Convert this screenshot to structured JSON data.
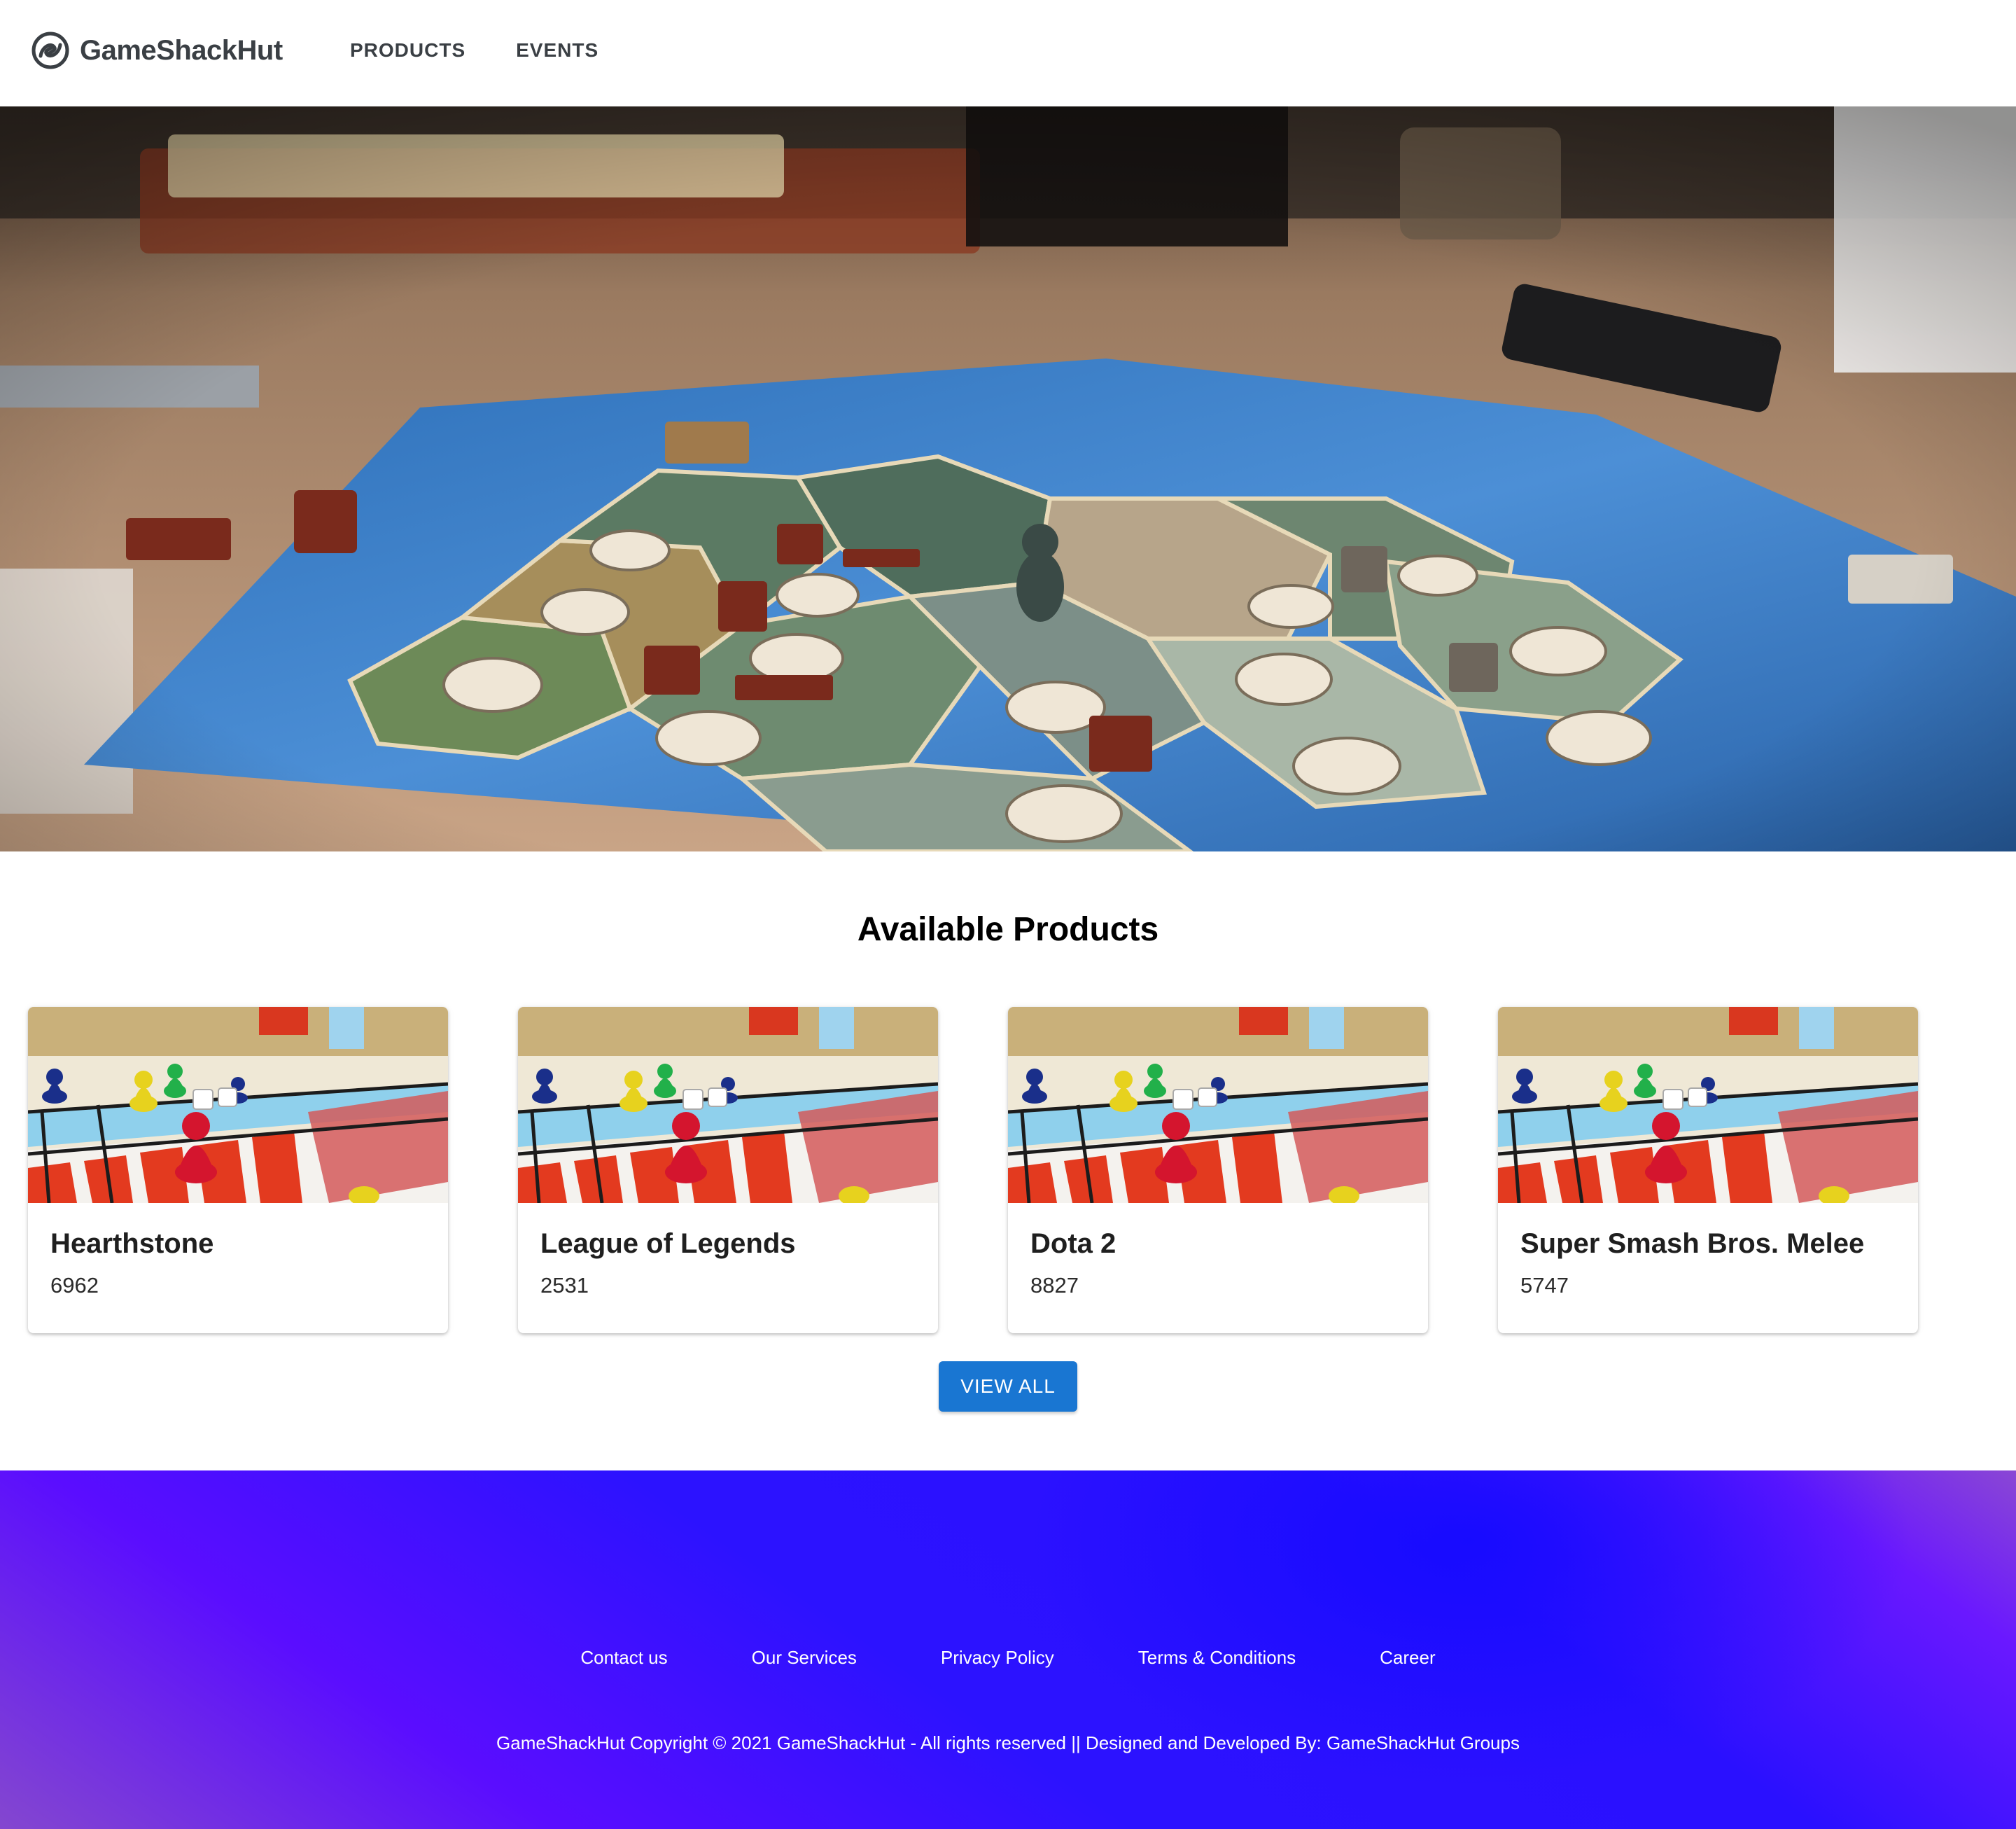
{
  "header": {
    "brand": "GameShackHut",
    "logo_icon": "brand-swirl-icon",
    "nav": [
      {
        "label": "PRODUCTS"
      },
      {
        "label": "EVENTS"
      }
    ]
  },
  "hero": {
    "image": "board-game-on-table-photo"
  },
  "products": {
    "title": "Available Products",
    "items": [
      {
        "title": "Hearthstone",
        "value": "6962",
        "image": "ludo-board-photo"
      },
      {
        "title": "League of Legends",
        "value": "2531",
        "image": "ludo-board-photo"
      },
      {
        "title": "Dota 2",
        "value": "8827",
        "image": "ludo-board-photo"
      },
      {
        "title": "Super Smash Bros. Melee",
        "value": "5747",
        "image": "ludo-board-photo"
      }
    ],
    "view_all_label": "VIEW ALL"
  },
  "footer": {
    "links": [
      {
        "label": "Contact us"
      },
      {
        "label": "Our Services"
      },
      {
        "label": "Privacy Policy"
      },
      {
        "label": "Terms & Conditions"
      },
      {
        "label": "Career"
      }
    ],
    "copyright": "GameShackHut Copyright © 2021 GameShackHut - All rights reserved || Designed and Developed By: GameShackHut Groups"
  },
  "colors": {
    "accent": "#1976d2",
    "nav_text": "#3a3f44",
    "footer_gradient": [
      "#8a47d4",
      "#2a10ff",
      "#5a0dff"
    ]
  }
}
